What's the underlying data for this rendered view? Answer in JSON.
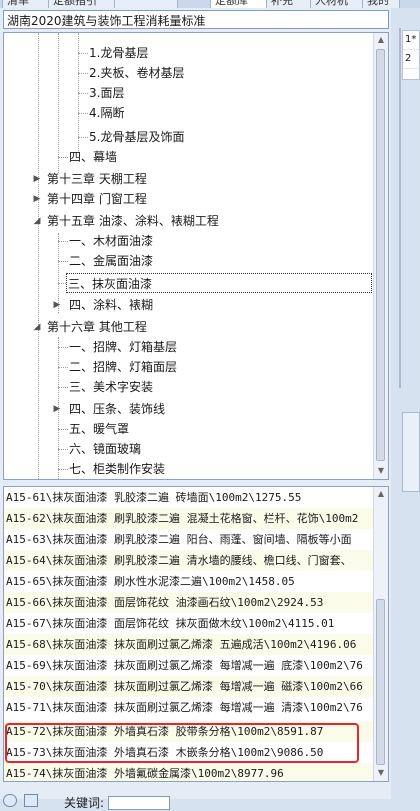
{
  "tabs": [
    {
      "label": "清单"
    },
    {
      "label": "定额指引"
    },
    {
      "label": "定额库"
    },
    {
      "label": "补充"
    },
    {
      "label": "人材机"
    },
    {
      "label": "我的"
    }
  ],
  "library_combo": {
    "value": "湖南2020建筑与装饰工程消耗量标准"
  },
  "tree": {
    "nodes": [
      {
        "label": "1.龙骨基层"
      },
      {
        "label": "2.夹板、卷材基层"
      },
      {
        "label": "3.面层"
      },
      {
        "label": "4.隔断"
      },
      {
        "label": "5.龙骨基层及饰面"
      },
      {
        "label": "四、幕墙"
      },
      {
        "label": "第十三章 天棚工程"
      },
      {
        "label": "第十四章 门窗工程"
      },
      {
        "label": "第十五章 油漆、涂料、裱糊工程"
      },
      {
        "label": "一、木材面油漆"
      },
      {
        "label": "二、金属面油漆"
      },
      {
        "label": "三、抹灰面油漆"
      },
      {
        "label": "四、涂料、裱糊"
      },
      {
        "label": "第十六章 其他工程"
      },
      {
        "label": "一、招牌、灯箱基层"
      },
      {
        "label": "二、招牌、灯箱面层"
      },
      {
        "label": "三、美术字安装"
      },
      {
        "label": "四、压条、装饰线"
      },
      {
        "label": "五、暖气罩"
      },
      {
        "label": "六、镜面玻璃"
      },
      {
        "label": "七、柜类制作安装"
      }
    ]
  },
  "quota_list": {
    "rows": [
      {
        "text": "A15-61\\抹灰面油漆 乳胶漆二遍 砖墙面\\100m2\\1275.55"
      },
      {
        "text": "A15-62\\抹灰面油漆 刷乳胶漆二遍 混凝土花格窗、栏杆、花饰\\100m2"
      },
      {
        "text": "A15-63\\抹灰面油漆 刷乳胶漆二遍 阳台、雨蓬、窗间墙、隔板等小面"
      },
      {
        "text": "A15-64\\抹灰面油漆 刷乳胶漆二遍 清水墙的腰线、檐口线、门窗套、"
      },
      {
        "text": "A15-65\\抹灰面油漆 刷水性水泥漆二遍\\100m2\\1458.05"
      },
      {
        "text": "A15-66\\抹灰面油漆 面层饰花纹 油漆画石纹\\100m2\\2924.53"
      },
      {
        "text": "A15-67\\抹灰面油漆 面层饰花纹 抹灰面做木纹\\100m2\\4115.01"
      },
      {
        "text": "A15-68\\抹灰面油漆 抹灰面刷过氯乙烯漆 五遍成活\\100m2\\4196.06"
      },
      {
        "text": "A15-69\\抹灰面油漆 抹灰面刷过氯乙烯漆 每增减一遍 底漆\\100m2\\76"
      },
      {
        "text": "A15-70\\抹灰面油漆 抹灰面刷过氯乙烯漆 每增减一遍 磁漆\\100m2\\66"
      },
      {
        "text": "A15-71\\抹灰面油漆 抹灰面刷过氯乙烯漆 每增减一遍 清漆\\100m2\\76"
      },
      {
        "text": "A15-72\\抹灰面油漆 外墙真石漆 胶带条分格\\100m2\\8591.87"
      },
      {
        "text": "A15-73\\抹灰面油漆 外墙真石漆 木嵌条分格\\100m2\\9086.50"
      },
      {
        "text": "A15-74\\抹灰面油漆 外墙氟碳金属漆\\100m2\\8977.96"
      }
    ]
  },
  "bottom_bar": {
    "keyword_label": "关键词:",
    "keyword_value": ""
  },
  "right_grid": {
    "rows": [
      {
        "text": "1*"
      },
      {
        "text": "2"
      }
    ]
  },
  "colors": {
    "highlight": "#e8252c",
    "tree_bg": "#ffffff",
    "panel_bg": "#e4ecf6"
  }
}
